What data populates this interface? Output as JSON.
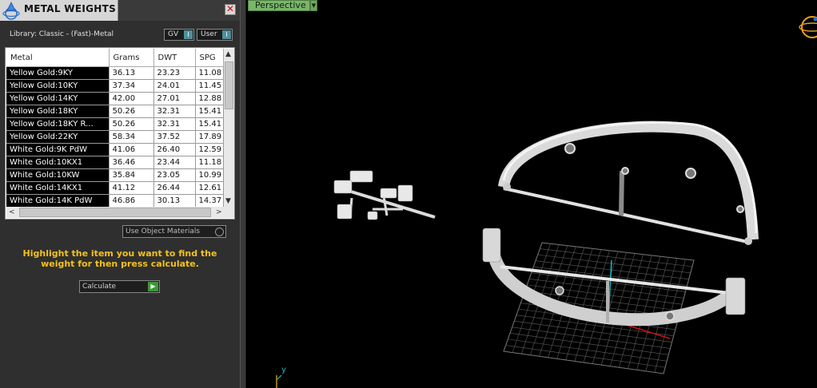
{
  "panel": {
    "title": "METAL WEIGHTS",
    "close_glyph": "✕",
    "library_label": "Library: Classic - (Fast)-Metal",
    "toggles": [
      {
        "label": "GV",
        "knob": "I"
      },
      {
        "label": "User",
        "knob": "I"
      }
    ],
    "table": {
      "headers": [
        "Metal",
        "Grams",
        "DWT",
        "SPG"
      ],
      "rows": [
        [
          "Yellow Gold:9KY",
          "36.13",
          "23.23",
          "11.08"
        ],
        [
          "Yellow Gold:10KY",
          "37.34",
          "24.01",
          "11.45"
        ],
        [
          "Yellow Gold:14KY",
          "42.00",
          "27.01",
          "12.88"
        ],
        [
          "Yellow Gold:18KY",
          "50.26",
          "32.31",
          "15.41"
        ],
        [
          "Yellow Gold:18KY R...",
          "50.26",
          "32.31",
          "15.41"
        ],
        [
          "Yellow Gold:22KY",
          "58.34",
          "37.52",
          "17.89"
        ],
        [
          "White Gold:9K PdW",
          "41.06",
          "26.40",
          "12.59"
        ],
        [
          "White Gold:10KX1",
          "36.46",
          "23.44",
          "11.18"
        ],
        [
          "White Gold:10KW",
          "35.84",
          "23.05",
          "10.99"
        ],
        [
          "White Gold:14KX1",
          "41.12",
          "26.44",
          "12.61"
        ],
        [
          "White Gold:14K PdW",
          "46.86",
          "30.13",
          "14.37"
        ]
      ]
    },
    "use_object_materials": "Use Object Materials",
    "instruction": "Highlight the item you want to find the weight for then press calculate.",
    "calculate": {
      "label": "Calculate",
      "glyph": "▶"
    }
  },
  "viewport": {
    "label": "Perspective",
    "dropdown_glyph": "▼",
    "axis_label": "y"
  },
  "colors": {
    "panel_bg": "#2f2f2f",
    "instruction": "#f3c21a",
    "viewport_label": "#7bb56c",
    "go_button": "#3a9a36",
    "axis_y": "#1bb8c8",
    "axis_x": "#d01010"
  }
}
